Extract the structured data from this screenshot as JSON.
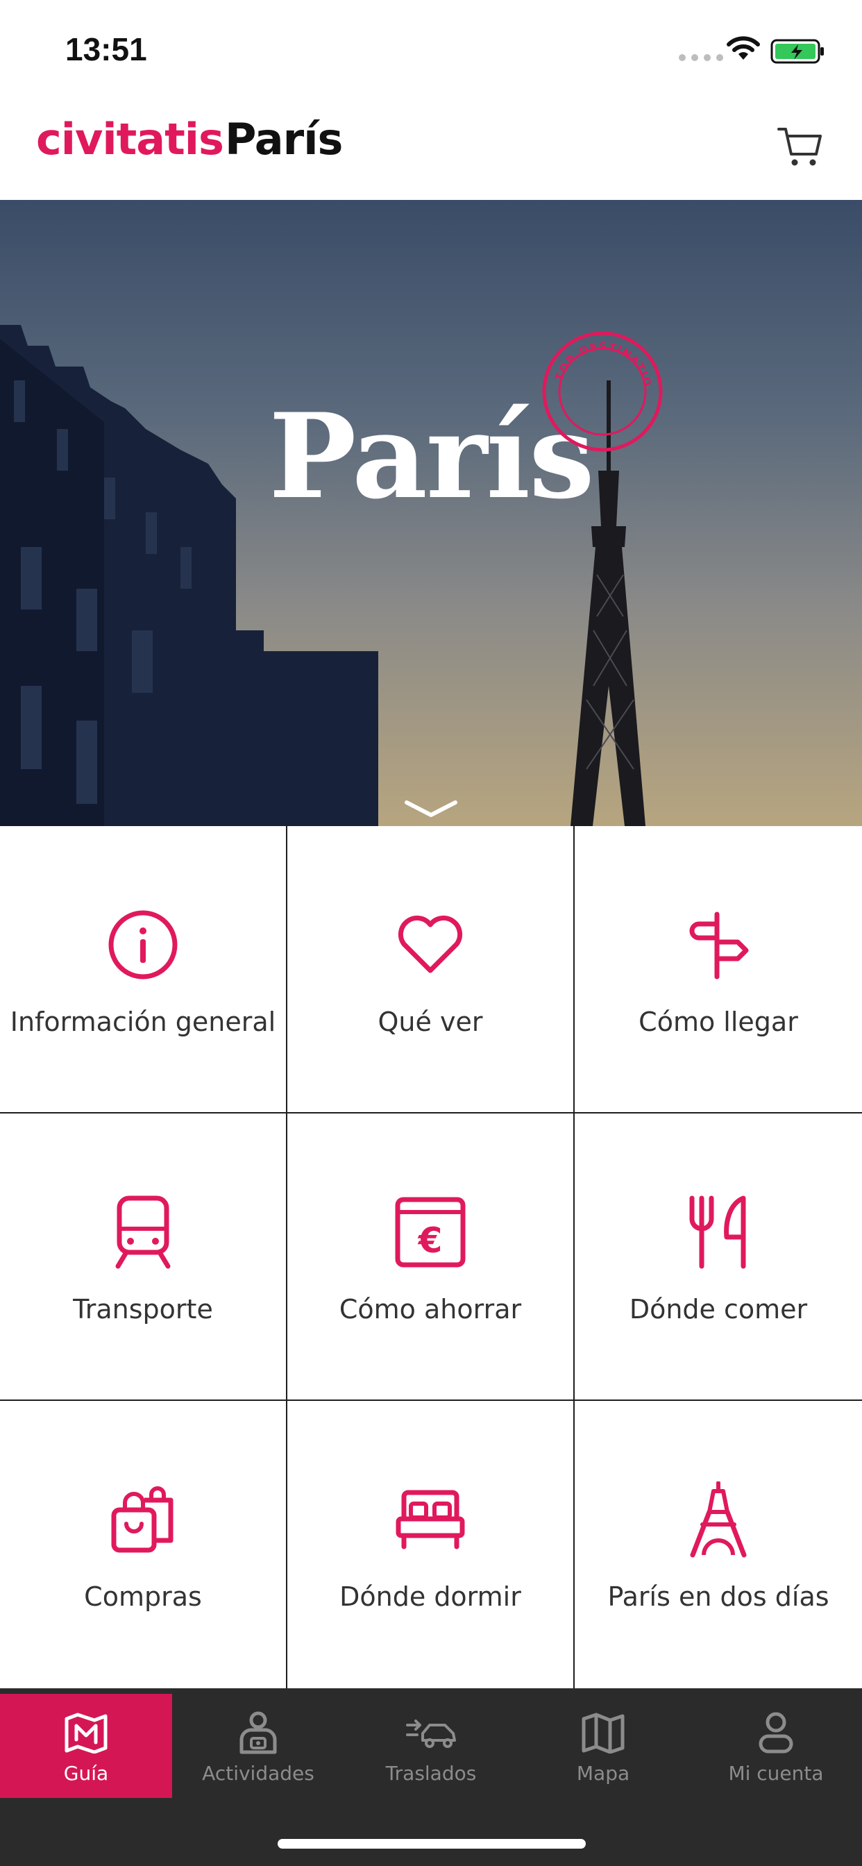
{
  "status_bar": {
    "time": "13:51"
  },
  "header": {
    "brand": "civitatis",
    "city": "París"
  },
  "hero": {
    "title": "París",
    "badge_text": "TOP DESTINATION"
  },
  "colors": {
    "accent": "#e0195d",
    "tab_active": "#d51654",
    "tab_bar_bg": "#2b2b2b"
  },
  "grid": [
    {
      "label": "Información general",
      "icon": "info-icon"
    },
    {
      "label": "Qué ver",
      "icon": "heart-icon"
    },
    {
      "label": "Cómo llegar",
      "icon": "signpost-icon"
    },
    {
      "label": "Transporte",
      "icon": "train-icon"
    },
    {
      "label": "Cómo ahorrar",
      "icon": "wallet-euro-icon"
    },
    {
      "label": "Dónde comer",
      "icon": "fork-knife-icon"
    },
    {
      "label": "Compras",
      "icon": "shopping-bags-icon"
    },
    {
      "label": "Dónde dormir",
      "icon": "bed-icon"
    },
    {
      "label": "París en dos días",
      "icon": "eiffel-tower-icon"
    }
  ],
  "tabs": [
    {
      "label": "Guía",
      "icon": "map-guide-icon",
      "active": true
    },
    {
      "label": "Actividades",
      "icon": "person-activity-icon",
      "active": false
    },
    {
      "label": "Traslados",
      "icon": "car-transfer-icon",
      "active": false
    },
    {
      "label": "Mapa",
      "icon": "map-icon",
      "active": false
    },
    {
      "label": "Mi cuenta",
      "icon": "user-icon",
      "active": false
    }
  ]
}
